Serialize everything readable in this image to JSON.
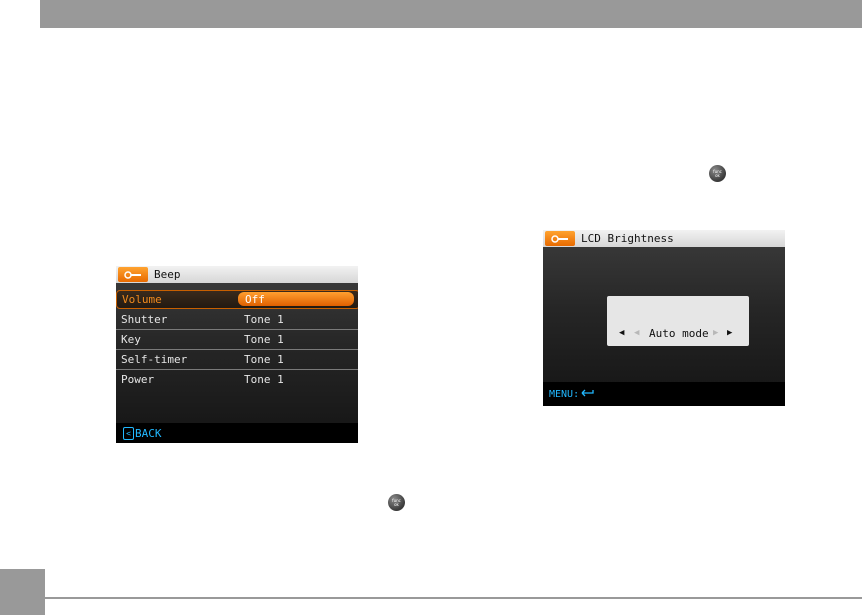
{
  "colors": {
    "accent": "#f08a1e",
    "highlight_text": "#21b8ff",
    "page_bar": "#999999"
  },
  "func_button": {
    "line1": "func",
    "line2": "ok"
  },
  "beep_screen": {
    "title": "Beep",
    "icon": "wrench-icon",
    "rows": [
      {
        "label": "Volume",
        "value": "Off",
        "selected": true
      },
      {
        "label": "Shutter",
        "value": "Tone 1"
      },
      {
        "label": "Key",
        "value": "Tone 1"
      },
      {
        "label": "Self-timer",
        "value": "Tone 1"
      },
      {
        "label": "Power",
        "value": "Tone 1"
      }
    ],
    "back_label": "BACK",
    "back_icon": "left-arrow-icon"
  },
  "lcd_screen": {
    "title": "LCD Brightness",
    "icon": "wrench-icon",
    "value": "Auto mode",
    "menu_label": "MENU:",
    "menu_icon": "return-icon"
  }
}
